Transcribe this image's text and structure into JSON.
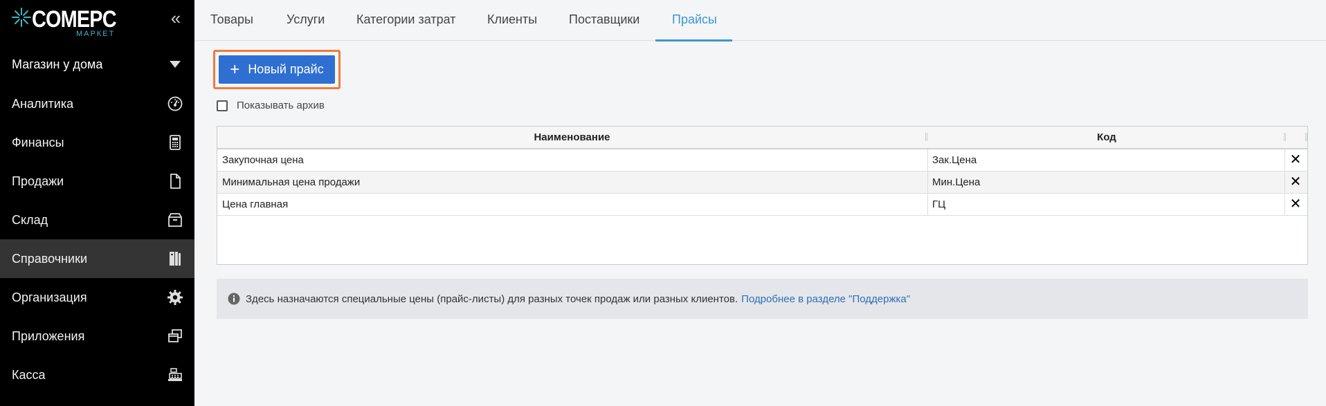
{
  "brand": {
    "name": "COMEPC",
    "sub": "МАРКЕТ",
    "accent": "#3fb8c6"
  },
  "sidebar": {
    "collapse_icon": "«",
    "store": "Магазин у дома",
    "items": [
      {
        "label": "Аналитика",
        "icon": "dashboard-gauge-icon"
      },
      {
        "label": "Финансы",
        "icon": "calculator-icon"
      },
      {
        "label": "Продажи",
        "icon": "document-icon"
      },
      {
        "label": "Склад",
        "icon": "box-icon"
      },
      {
        "label": "Справочники",
        "icon": "books-icon",
        "active": true
      },
      {
        "label": "Организация",
        "icon": "gear-icon"
      },
      {
        "label": "Приложения",
        "icon": "windows-icon"
      },
      {
        "label": "Касса",
        "icon": "cash-register-icon"
      }
    ]
  },
  "tabs": [
    "Товары",
    "Услуги",
    "Категории затрат",
    "Клиенты",
    "Поставщики",
    "Прайсы"
  ],
  "active_tab": "Прайсы",
  "new_button": {
    "plus": "+",
    "label": "Новый прайс"
  },
  "archive_label": "Показывать архив",
  "table": {
    "headers": [
      "Наименование",
      "Код"
    ],
    "rows": [
      {
        "name": "Закупочная цена",
        "code": "Зак.Цена",
        "delete": "✕"
      },
      {
        "name": "Минимальная цена продажи",
        "code": "Мин.Цена",
        "delete": "✕"
      },
      {
        "name": "Цена главная",
        "code": "ГЦ",
        "delete": "✕"
      }
    ]
  },
  "info": {
    "text": "Здесь назначаются специальные цены (прайс-листы) для разных точек продаж или разных клиентов.",
    "link": "Подробнее в разделе \"Поддержка\""
  },
  "colors": {
    "primary": "#2f6fd1",
    "highlight": "#f07a3c",
    "tab_active": "#3c96d2"
  }
}
